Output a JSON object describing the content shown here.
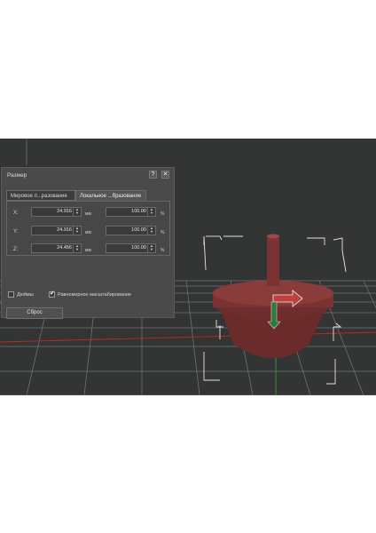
{
  "dialog": {
    "title": "Размер",
    "help_label": "?",
    "close_label": "✕",
    "tabs": [
      {
        "label": "Мировое п...разование"
      },
      {
        "label": "Локальное ...бразование"
      }
    ],
    "rows": [
      {
        "axis": "X:",
        "value": "24.916",
        "unit": "мм",
        "percent": "100.00",
        "percent_unit": "%"
      },
      {
        "axis": "Y:",
        "value": "24.916",
        "unit": "мм",
        "percent": "100.00",
        "percent_unit": "%"
      },
      {
        "axis": "Z:",
        "value": "24.456",
        "unit": "мм",
        "percent": "100.00",
        "percent_unit": "%"
      }
    ],
    "inches_label": "Дюймы",
    "inches_checked": false,
    "uniform_label": "Равномерное масштабирование",
    "uniform_checked": true,
    "reset_label": "Сброс"
  },
  "viewport": {
    "background_color": "#333434",
    "grid_color": "#6f7273",
    "red_axis_color": "#b52a2a",
    "object_color": "#7a3232",
    "gizmo": {
      "x_arrow_color": "#c0403c",
      "y_arrow_color": "#2f7a3a"
    }
  }
}
